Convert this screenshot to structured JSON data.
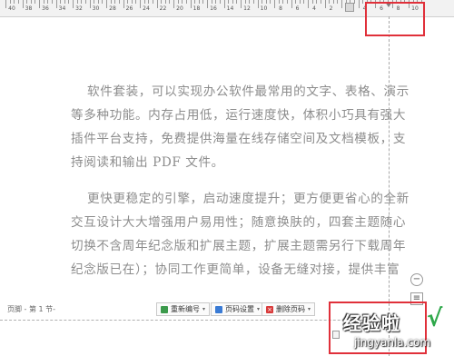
{
  "ruler": {
    "labels": [
      "40",
      "38",
      "36",
      "34",
      "32",
      "30",
      "28",
      "26",
      "24",
      "22",
      "20",
      "18",
      "16",
      "14",
      "12",
      "10",
      "8",
      "6",
      "4",
      "2",
      "2",
      "4",
      "6",
      "8",
      "10"
    ]
  },
  "document": {
    "paragraph1": [
      "软件套装，可以实现办公软件最常用的文字、表格、演示",
      "等多种功能。内存占用低，运行速度快，体积小巧具有强大",
      "插件平台支持，免费提供海量在线存储空间及文档模板，支",
      "持阅读和输出 PDF 文件。"
    ],
    "paragraph2": [
      "更快更稳定的引擎，启动速度提升；更方便更省心的全新",
      "交互设计大大增强用户易用性；随意换肤的，四套主题随心",
      "切换不含周年纪念版和扩展主题，扩展主题需另行下载周年",
      "纪念版已在）；协同工作更简单，设备无缝对接，提供丰富"
    ]
  },
  "footer_toolbar": {
    "label": "页脚 - 第 1 节-",
    "renumber_label": "重新编号",
    "page_settings_label": "页码设置",
    "delete_page_label": "删除页码"
  },
  "watermark": {
    "main": "经验啦",
    "check": "√",
    "url": "jingyanla.com"
  },
  "colors": {
    "highlight_box": "#e0303a",
    "body_text": "#8c8c8c",
    "watermark_check": "#2ea84a"
  },
  "icons": {
    "side_top": "minus-circle-icon",
    "side_bottom": "page-layout-icon",
    "renumber": "renumber-icon",
    "page_settings": "page-settings-icon",
    "delete_page": "delete-icon"
  }
}
